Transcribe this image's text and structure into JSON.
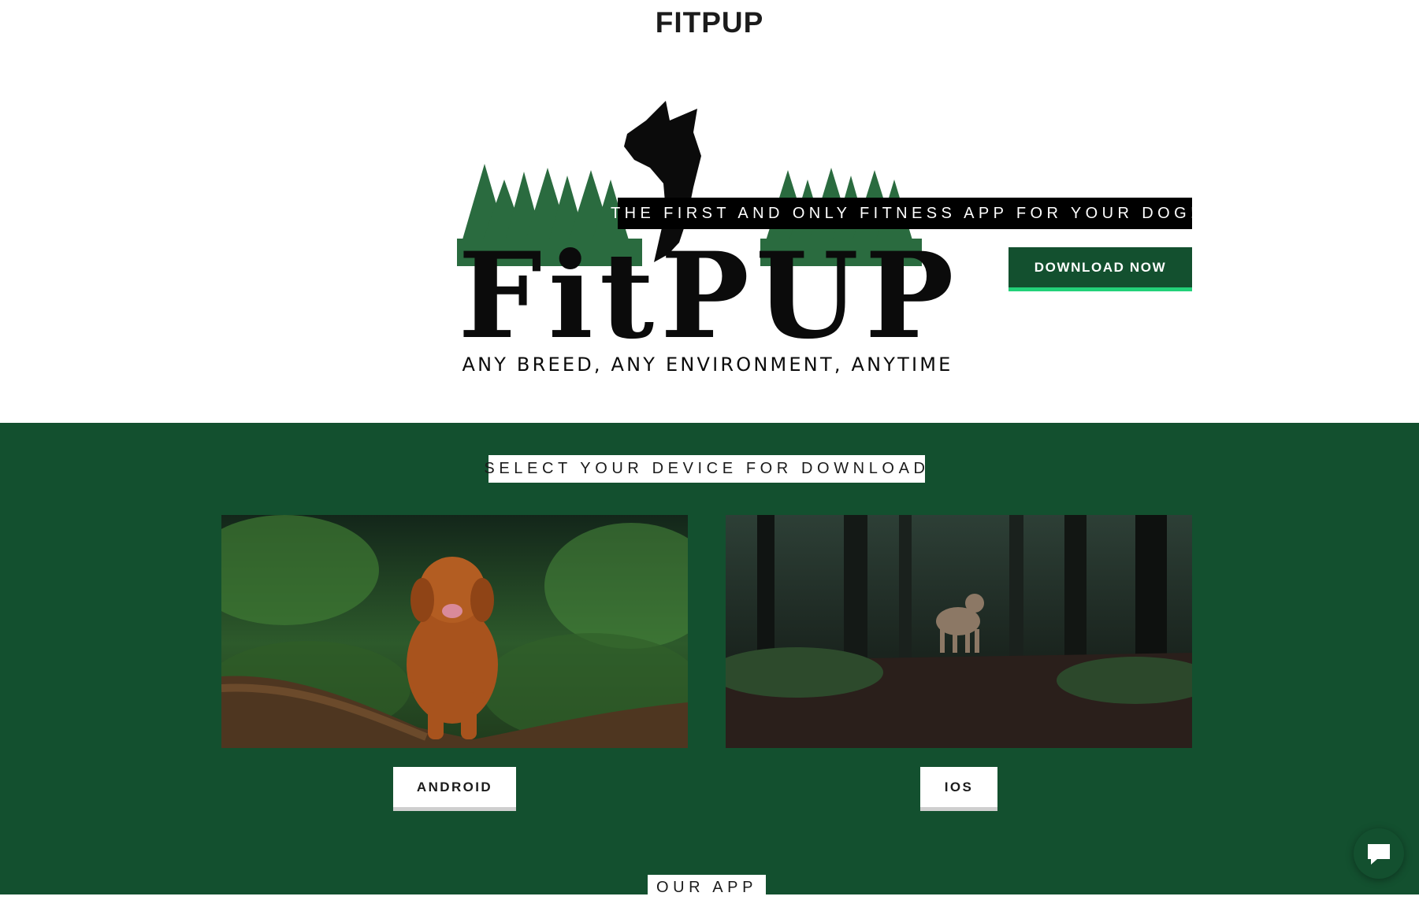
{
  "header": {
    "title": "FITPUP"
  },
  "hero": {
    "logo": {
      "wordmark": "FitPUP",
      "slogan": "ANY BREED, ANY ENVIRONMENT, ANYTIME"
    },
    "tagline": "THE FIRST AND ONLY FITNESS APP FOR YOUR DOG!",
    "download_button": "DOWNLOAD NOW"
  },
  "download_section": {
    "heading": "SELECT YOUR DEVICE FOR DOWNLOAD",
    "devices": [
      {
        "label": "ANDROID"
      },
      {
        "label": "IOS"
      }
    ]
  },
  "next_section": {
    "heading": "OUR APP"
  },
  "colors": {
    "brand_green": "#13502f",
    "accent_green": "#23d179",
    "tree_green": "#2a6b3f"
  },
  "icons": {
    "chat": "chat-bubble-icon"
  }
}
